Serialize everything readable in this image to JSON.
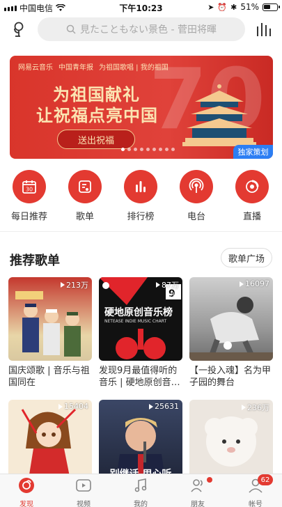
{
  "status": {
    "carrier": "中国电信",
    "time": "下午10:23",
    "battery": "51%"
  },
  "search": {
    "placeholder": "見たこともない景色 - 菅田将暉"
  },
  "banner": {
    "brand_items": [
      "网易云音乐",
      "中国青年报",
      "为祖国歌唱 | 我的祖国"
    ],
    "line1": "为祖国献礼",
    "line2": "让祝福点亮中国",
    "cta": "送出祝福",
    "big_number": "70",
    "tag": "独家策划",
    "dots_total": 9,
    "dots_active_index": 0
  },
  "categories": [
    {
      "label": "每日推荐",
      "icon": "calendar-icon",
      "day": "30"
    },
    {
      "label": "歌单",
      "icon": "playlist-icon"
    },
    {
      "label": "排行榜",
      "icon": "chart-bars-icon"
    },
    {
      "label": "电台",
      "icon": "radio-icon"
    },
    {
      "label": "直播",
      "icon": "live-icon"
    }
  ],
  "section": {
    "title": "推荐歌单",
    "more_button": "歌单广场"
  },
  "playlists": [
    {
      "count": "213万",
      "title": "国庆颂歌 | 音乐与祖国同在",
      "accent": "#b32a22"
    },
    {
      "count": "87万",
      "title": "发现9月最值得听的音乐 | 硬地原创音…",
      "accent": "#111111",
      "cover_text": "硬地原创音乐榜",
      "cover_sub": "NETEASE INDIE MUSIC CHART",
      "cover_badge": "9月榜"
    },
    {
      "count": "16097",
      "title": "【一投入魂】名为甲子园的舞台",
      "accent": "#8c8c8c"
    },
    {
      "count": "15404",
      "title": "",
      "accent": "#f4e3c9"
    },
    {
      "count": "25631",
      "title": "",
      "accent": "#20263a",
      "cover_text": "别继话 用心听"
    },
    {
      "count": "236万",
      "title": "",
      "accent": "#e7e1db"
    }
  ],
  "tabs": [
    {
      "label": "发现",
      "icon": "discover-icon",
      "active": true
    },
    {
      "label": "视频",
      "icon": "video-icon",
      "active": false
    },
    {
      "label": "我的",
      "icon": "music-note-icon",
      "active": false
    },
    {
      "label": "朋友",
      "icon": "friends-icon",
      "active": false,
      "dot": true
    },
    {
      "label": "帐号",
      "icon": "account-icon",
      "active": false,
      "badge": "62"
    }
  ],
  "colors": {
    "brand_red": "#e33a31",
    "tag_blue": "#2c7ef3",
    "banner_gold": "#fbe4b2"
  }
}
